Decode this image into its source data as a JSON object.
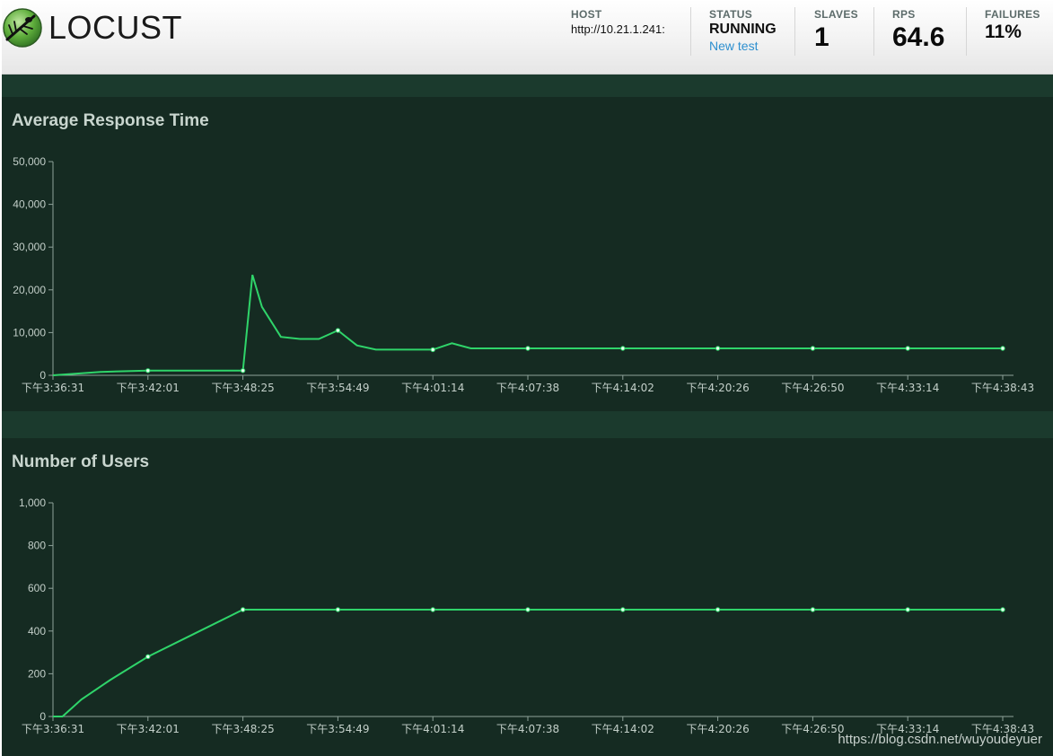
{
  "brand": {
    "name": "LOCUST",
    "logo_icon": "locust-logo-icon"
  },
  "header": {
    "host": {
      "label": "HOST",
      "value": "http://10.21.1.241:"
    },
    "status": {
      "label": "STATUS",
      "value": "RUNNING",
      "new_test_label": "New test"
    },
    "slaves": {
      "label": "SLAVES",
      "value": "1"
    },
    "rps": {
      "label": "RPS",
      "value": "64.6"
    },
    "failures": {
      "label": "FAILURES",
      "value": "11%"
    }
  },
  "colors": {
    "line": "#2fd46a",
    "panel_bg": "#152b22",
    "outer_bg": "#1b3a2d",
    "axis": "#8fa39a",
    "link": "#2d8fcf"
  },
  "watermark": "https://blog.csdn.net/wuyoudeyuer",
  "chart_data": [
    {
      "type": "line",
      "title": "Average Response Time",
      "ylim": [
        0,
        50000
      ],
      "yticks": [
        "0",
        "10,000",
        "20,000",
        "30,000",
        "40,000",
        "50,000"
      ],
      "ytick_values": [
        0,
        10000,
        20000,
        30000,
        40000,
        50000
      ],
      "xtick_labels": [
        "下午3:36:31",
        "下午3:42:01",
        "下午3:48:25",
        "下午3:54:49",
        "下午4:01:14",
        "下午4:07:38",
        "下午4:14:02",
        "下午4:20:26",
        "下午4:26:50",
        "下午4:33:14",
        "下午4:38:43"
      ],
      "x": [
        0,
        0.5,
        1,
        1.5,
        2,
        2.1,
        2.2,
        2.4,
        2.6,
        2.8,
        3.0,
        3.2,
        3.4,
        3.6,
        3.8,
        4.0,
        4.2,
        4.4,
        4.6,
        4.8,
        5,
        6,
        7,
        8,
        9,
        10
      ],
      "series": [
        {
          "values": [
            0,
            800,
            1100,
            1100,
            1100,
            23500,
            16000,
            9000,
            8500,
            8500,
            10500,
            7000,
            6000,
            6000,
            6000,
            6000,
            7500,
            6300,
            6300,
            6300,
            6300,
            6300,
            6300,
            6300,
            6300,
            6300
          ]
        }
      ],
      "marker_x": [
        1,
        2,
        3,
        4,
        5,
        6,
        7,
        8,
        9,
        10
      ]
    },
    {
      "type": "line",
      "title": "Number of Users",
      "ylim": [
        0,
        1000
      ],
      "yticks": [
        "0",
        "200",
        "400",
        "600",
        "800",
        "1,000"
      ],
      "ytick_values": [
        0,
        200,
        400,
        600,
        800,
        1000
      ],
      "xtick_labels": [
        "下午3:36:31",
        "下午3:42:01",
        "下午3:48:25",
        "下午3:54:49",
        "下午4:01:14",
        "下午4:07:38",
        "下午4:14:02",
        "下午4:20:26",
        "下午4:26:50",
        "下午4:33:14",
        "下午4:38:43"
      ],
      "x": [
        0,
        0.1,
        0.3,
        0.6,
        1.0,
        1.5,
        2.0,
        2.2,
        3,
        4,
        5,
        6,
        7,
        8,
        9,
        10
      ],
      "series": [
        {
          "values": [
            0,
            0,
            80,
            170,
            280,
            390,
            500,
            500,
            500,
            500,
            500,
            500,
            500,
            500,
            500,
            500
          ]
        }
      ],
      "marker_x": [
        1,
        2,
        3,
        4,
        5,
        6,
        7,
        8,
        9,
        10
      ]
    }
  ]
}
